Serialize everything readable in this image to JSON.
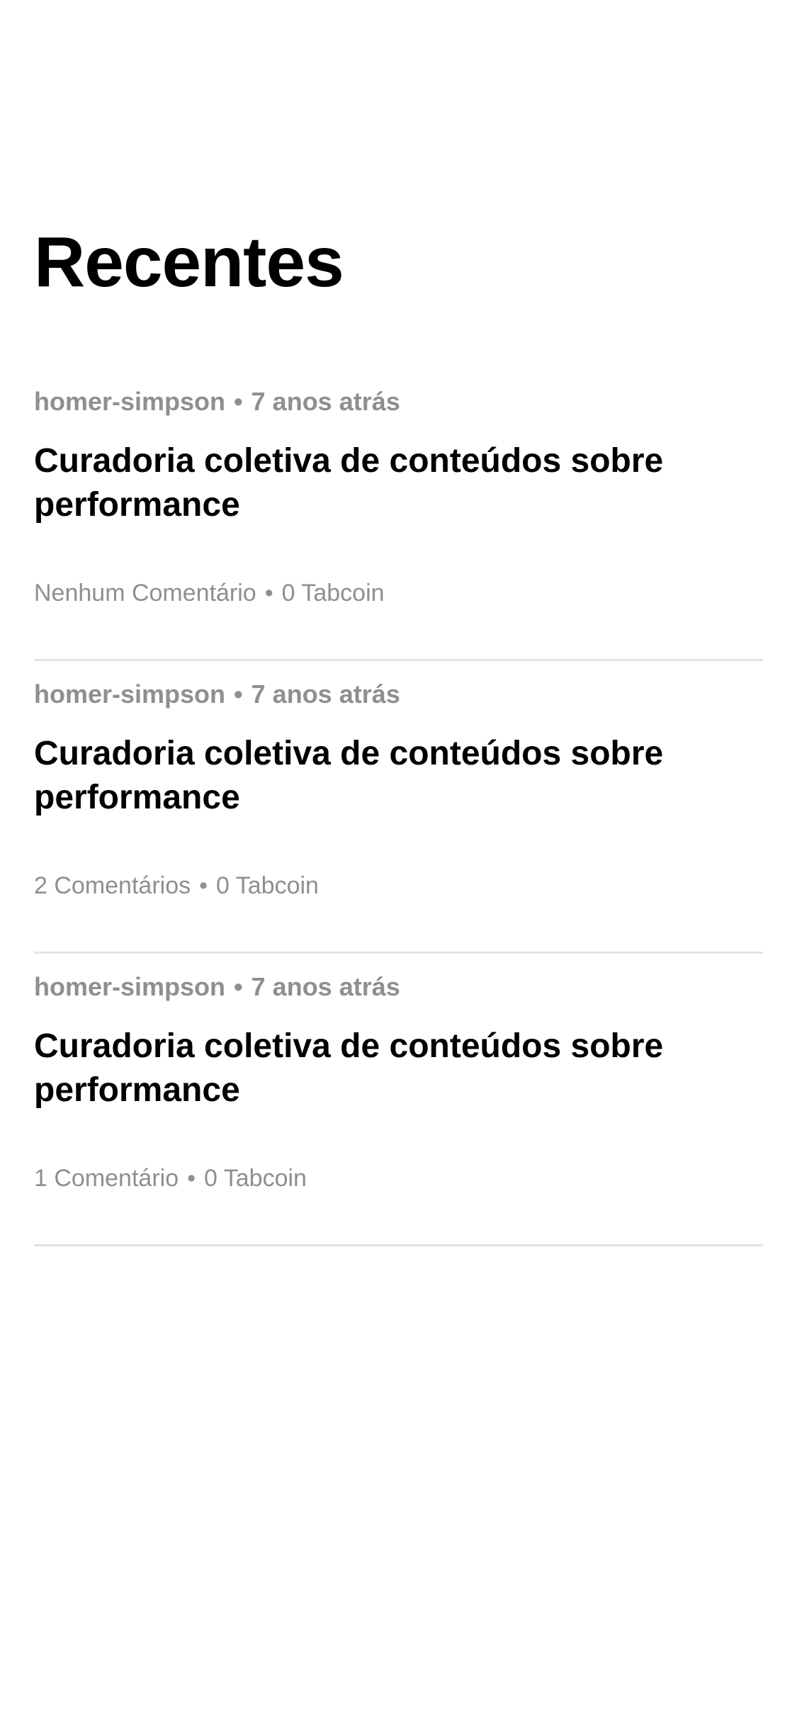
{
  "page": {
    "title": "Recentes"
  },
  "separator": "•",
  "posts": [
    {
      "author": "homer-simpson",
      "time": "7 anos atrás",
      "title": "Curadoria coletiva de conteúdos sobre performance",
      "comments": "Nenhum Comentário",
      "tabcoins": "0 Tabcoin"
    },
    {
      "author": "homer-simpson",
      "time": "7 anos atrás",
      "title": "Curadoria coletiva de conteúdos sobre performance",
      "comments": "2 Comentários",
      "tabcoins": "0 Tabcoin"
    },
    {
      "author": "homer-simpson",
      "time": "7 anos atrás",
      "title": "Curadoria coletiva de conteúdos sobre performance",
      "comments": "1 Comentário",
      "tabcoins": "0 Tabcoin"
    }
  ],
  "colors": {
    "background": "#ffffff",
    "text_primary": "#000000",
    "text_secondary": "#8e8e93",
    "divider": "#e3e3e3"
  }
}
